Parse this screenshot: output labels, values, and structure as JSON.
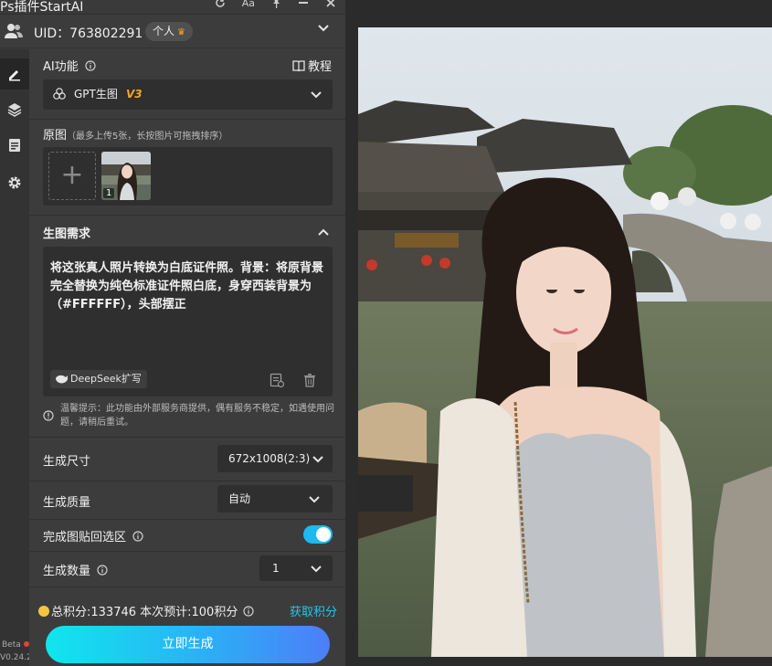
{
  "titlebar": {
    "title": "Ps插件StartAI",
    "icons": [
      "refresh-icon",
      "font-size-icon",
      "pin-icon",
      "minimize-icon",
      "close-icon"
    ],
    "font_icon_label": "Aa"
  },
  "user": {
    "uid_text": "UID：763802291",
    "account_type": "个人",
    "icon": "users-icon"
  },
  "sidebar": {
    "items": [
      {
        "icon": "edit-icon",
        "active": true
      },
      {
        "icon": "layers-icon",
        "active": false
      },
      {
        "icon": "document-icon",
        "active": false
      },
      {
        "icon": "gear-icon",
        "active": false
      }
    ],
    "beta_label": "Beta",
    "version": "V0.24.2"
  },
  "ai_function": {
    "label": "AI功能",
    "tutorial_label": "教程",
    "model_name": "GPT生图",
    "model_version": "V3"
  },
  "source_image": {
    "label": "原图",
    "hint": "（最多上传5张，长按图片可拖拽排序）",
    "thumbnail_index": "1"
  },
  "prompt": {
    "label": "生图需求",
    "text": "将这张真人照片转换为白底证件照。背景：将原背景完全替换为纯色标准证件照白底，身穿西装背景为（#FFFFFF），头部摆正",
    "deepseek_label": "DeepSeek扩写"
  },
  "notice": {
    "text": "温馨提示：此功能由外部服务商提供，偶有服务不稳定，如遇使用问题，请稍后重试。"
  },
  "settings": {
    "size_label": "生成尺寸",
    "size_value": "672x1008(2:3)",
    "quality_label": "生成质量",
    "quality_value": "自动",
    "paste_back_label": "完成图贴回选区",
    "paste_back_enabled": true,
    "count_label": "生成数量",
    "count_value": "1"
  },
  "footer": {
    "credits_text": "总积分:133746  本次预计:100积分",
    "get_credits_label": "获取积分",
    "generate_label": "立即生成"
  },
  "colors": {
    "accent": "#1fb8f0",
    "model_version": "#f5a623",
    "panel_bg": "#3c3c3c",
    "field_bg": "#2f2f2f"
  }
}
